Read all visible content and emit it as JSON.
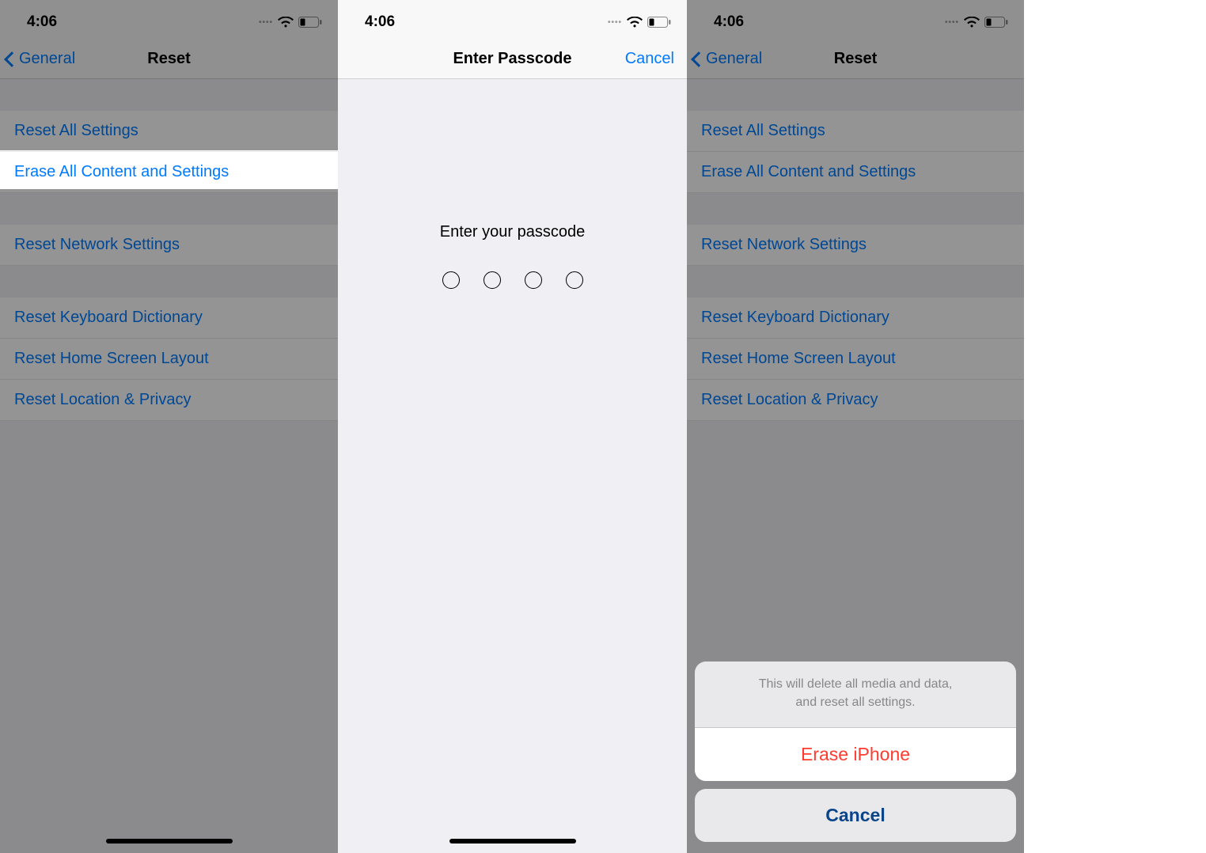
{
  "status": {
    "time": "4:06"
  },
  "screen1": {
    "back": "General",
    "title": "Reset",
    "items": {
      "reset_all": "Reset All Settings",
      "erase_all": "Erase All Content and Settings",
      "reset_network": "Reset Network Settings",
      "reset_keyboard": "Reset Keyboard Dictionary",
      "reset_home": "Reset Home Screen Layout",
      "reset_location": "Reset Location & Privacy"
    }
  },
  "screen2": {
    "title": "Enter Passcode",
    "cancel": "Cancel",
    "prompt": "Enter your passcode"
  },
  "screen3": {
    "back": "General",
    "title": "Reset",
    "items": {
      "reset_all": "Reset All Settings",
      "erase_all": "Erase All Content and Settings",
      "reset_network": "Reset Network Settings",
      "reset_keyboard": "Reset Keyboard Dictionary",
      "reset_home": "Reset Home Screen Layout",
      "reset_location": "Reset Location & Privacy"
    },
    "sheet": {
      "message_line1": "This will delete all media and data,",
      "message_line2": "and reset all settings.",
      "erase": "Erase iPhone",
      "cancel": "Cancel"
    }
  }
}
